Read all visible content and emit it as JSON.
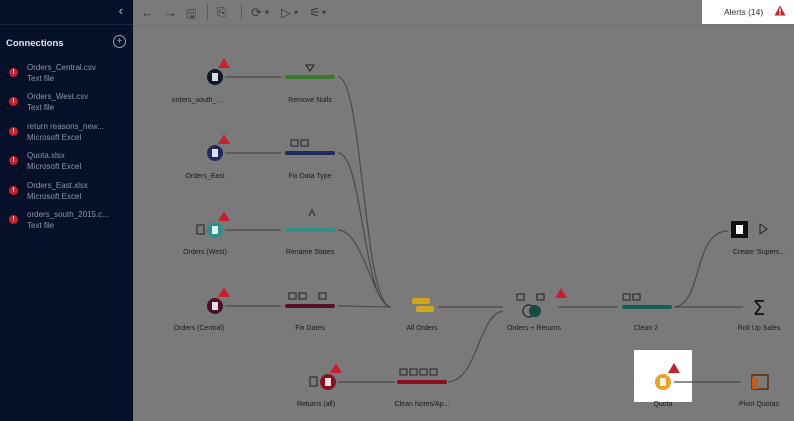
{
  "sidebar": {
    "collapse_glyph": "‹",
    "title": "Connections",
    "add_glyph": "+",
    "items": [
      {
        "name": "Orders_Central.csv",
        "type": "Text file"
      },
      {
        "name": "Orders_West.csv",
        "type": "Text file"
      },
      {
        "name": "return reasons_new...",
        "type": "Microsoft Excel"
      },
      {
        "name": "Quota.xlsx",
        "type": "Microsoft Excel"
      },
      {
        "name": "Orders_East.xlsx",
        "type": "Microsoft Excel"
      },
      {
        "name": "orders_south_2015.c...",
        "type": "Text file"
      }
    ]
  },
  "toolbar": {
    "back": "←",
    "forward": "→",
    "save": "🖫",
    "paste": "⎘",
    "refresh": "⟳",
    "run": "▷",
    "settings": "⚟",
    "caret": "▾"
  },
  "alerts": {
    "label": "Alerts (14)",
    "icon": "warning-icon"
  },
  "colors": {
    "accent_error": "#c8202f",
    "green_step": "#3a7a2c",
    "blue_step": "#1f2a5e",
    "teal_step": "#2f8f89",
    "maroon_step": "#5b0f2a",
    "red_step": "#8a1020",
    "darkteal_step": "#145c55",
    "union": "#d4a51a",
    "quota": "#f0a020"
  },
  "flow": {
    "inputs": [
      {
        "label": "orders_south_..."
      },
      {
        "label": "Orders_East"
      },
      {
        "label": "Orders (West)"
      },
      {
        "label": "Orders (Central)"
      },
      {
        "label": "Returns (all)"
      }
    ],
    "steps": [
      {
        "label": "Remove Nulls"
      },
      {
        "label": "Fix Data Type"
      },
      {
        "label": "Rename States"
      },
      {
        "label": "Fix Dates"
      },
      {
        "label": "Clean Notes/Ap..."
      }
    ],
    "union": {
      "label": "All Orders"
    },
    "join": {
      "label": "Orders + Returns"
    },
    "clean2": {
      "label": "Clean 2"
    },
    "output": {
      "label": "Create 'Supers..."
    },
    "aggregate": {
      "label": "Roll Up Sales"
    },
    "quota": {
      "label": "Quota"
    },
    "pivot": {
      "label": "Pivot Quotas"
    }
  }
}
